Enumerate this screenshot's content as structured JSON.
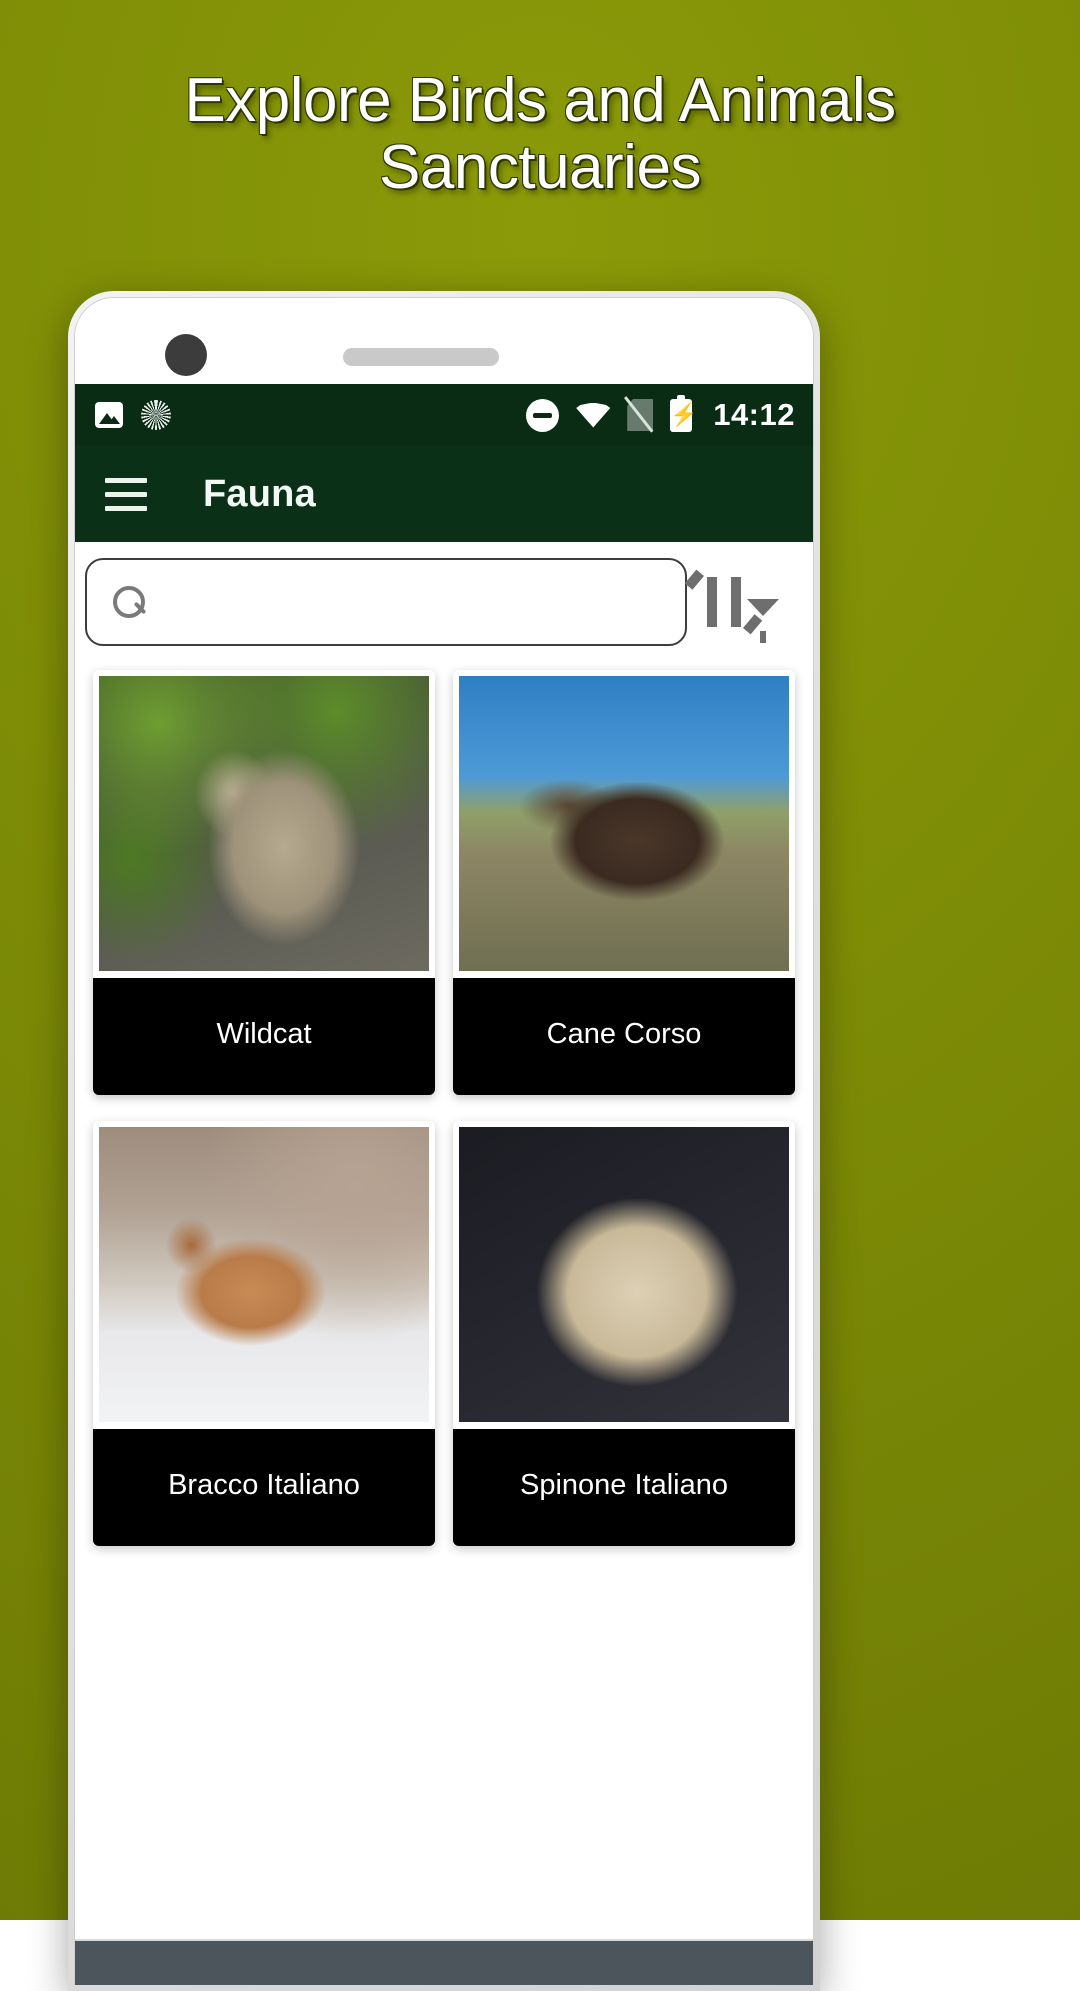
{
  "promo": {
    "headline": "Explore Birds and Animals\nSanctuaries",
    "background_color": "#7d8c06",
    "headline_color": "#ffffff"
  },
  "phone": {
    "bezel": {
      "camera_icon": "camera-dot",
      "speaker_icon": "earpiece-speaker"
    },
    "status_bar": {
      "background_color": "#0a2b14",
      "time": "14:12",
      "left_icons": [
        {
          "name": "image-icon",
          "label": "Screenshot"
        },
        {
          "name": "sync-icon",
          "label": "Sync"
        }
      ],
      "right_icons": [
        {
          "name": "do-not-disturb-icon",
          "label": "Do Not Disturb"
        },
        {
          "name": "wifi-icon",
          "label": "Wi-Fi"
        },
        {
          "name": "sim-off-icon",
          "label": "No SIM"
        },
        {
          "name": "battery-charging-icon",
          "label": "Battery charging"
        }
      ]
    },
    "app_bar": {
      "background_color": "#0b3018",
      "menu_icon": "hamburger-menu-icon",
      "title": "Fauna"
    },
    "search": {
      "icon": "search-icon",
      "value": "",
      "placeholder": "",
      "sort_icon": "sort-filter-icon"
    },
    "grid": {
      "cards": [
        {
          "title": "Wildcat",
          "image": "wildcat-photo",
          "image_class": "img-wildcat"
        },
        {
          "title": "Cane Corso",
          "image": "cane-corso-photo",
          "image_class": "img-canecorso"
        },
        {
          "title": "Bracco Italiano",
          "image": "bracco-italiano-photo",
          "image_class": "img-bracco"
        },
        {
          "title": "Spinone Italiano",
          "image": "spinone-italiano-photo",
          "image_class": "img-spinone"
        }
      ],
      "label_background": "#000000",
      "label_color": "#ffffff"
    },
    "bottom_bar": {
      "background_color": "#4b555b"
    }
  }
}
